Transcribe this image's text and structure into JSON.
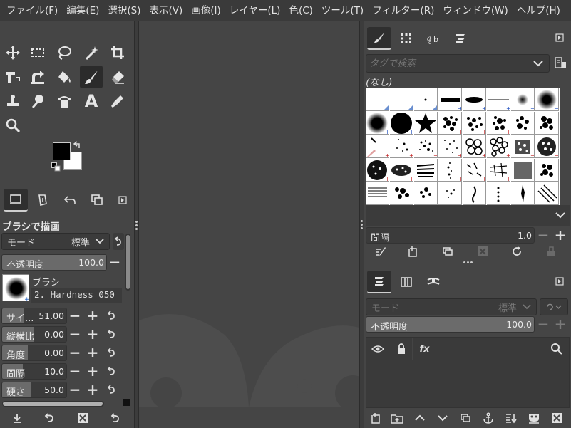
{
  "menubar": {
    "items": [
      "ファイル(F)",
      "編集(E)",
      "選択(S)",
      "表示(V)",
      "画像(I)",
      "レイヤー(L)",
      "色(C)",
      "ツール(T)",
      "フィルター(R)",
      "ウィンドウ(W)",
      "ヘルプ(H)"
    ]
  },
  "tools": [
    {
      "name": "move-tool-icon",
      "active": false
    },
    {
      "name": "rect-select-tool-icon",
      "active": false
    },
    {
      "name": "free-select-tool-icon",
      "active": false
    },
    {
      "name": "fuzzy-select-tool-icon",
      "active": false
    },
    {
      "name": "crop-tool-icon",
      "active": false
    },
    {
      "name": "transform-tool-icon",
      "active": false
    },
    {
      "name": "warp-tool-icon",
      "active": false
    },
    {
      "name": "bucket-fill-tool-icon",
      "active": false
    },
    {
      "name": "paintbrush-tool-icon",
      "active": true
    },
    {
      "name": "eraser-tool-icon",
      "active": false
    },
    {
      "name": "clone-tool-icon",
      "active": false
    },
    {
      "name": "smudge-tool-icon",
      "active": false
    },
    {
      "name": "path-tool-icon",
      "active": false
    },
    {
      "name": "text-tool-icon",
      "active": false
    },
    {
      "name": "color-picker-tool-icon",
      "active": false
    },
    {
      "name": "zoom-tool-icon",
      "active": false
    }
  ],
  "colors": {
    "foreground": "#000000",
    "background": "#ffffff",
    "accent": "#4aa0e0",
    "panel": "#454545"
  },
  "text_tool_glyph": "A",
  "tool_options": {
    "title": "ブラシで描画",
    "mode_label": "モード",
    "mode_value": "標準",
    "opacity_label": "不透明度",
    "opacity_value": "100.0",
    "brush_label": "ブラシ",
    "brush_name": "2. Hardness 050",
    "sliders": [
      {
        "label": "サイ...",
        "value": "51.00",
        "fill": 0.33
      },
      {
        "label": "縦横比",
        "value": "0.00",
        "fill": 0.32
      },
      {
        "label": "角度",
        "value": "0.00",
        "fill": 0.26
      },
      {
        "label": "間隔",
        "value": "10.0",
        "fill": 0.22
      },
      {
        "label": "硬さ",
        "value": "50.0",
        "fill": 0.3
      }
    ]
  },
  "brushes_panel": {
    "tag_placeholder": "タグで検索",
    "none_label": "(なし)",
    "spacing_label": "間隔",
    "spacing_value": "1.0"
  },
  "layers_panel": {
    "mode_label": "モード",
    "mode_value": "標準",
    "opacity_label": "不透明度",
    "opacity_value": "100.0",
    "fx_label": "fx"
  }
}
